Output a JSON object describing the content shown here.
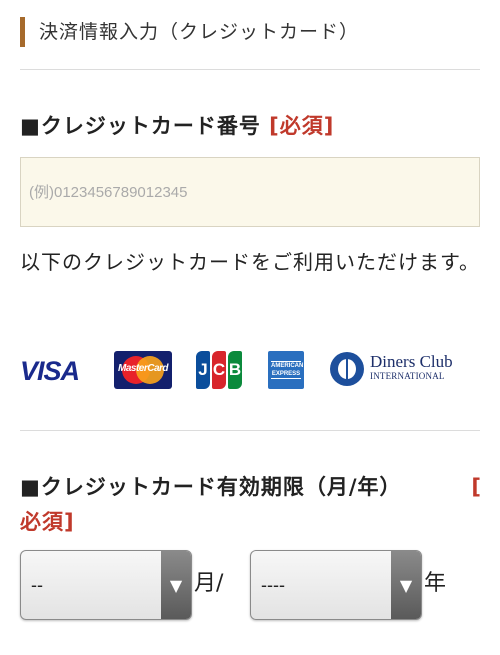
{
  "header": {
    "title": "決済情報入力（クレジットカード）"
  },
  "card_number": {
    "title": "■クレジットカード番号",
    "required": "[必須]",
    "placeholder": "(例)0123456789012345",
    "value": ""
  },
  "notice": "以下のクレジットカードをご利用いただけます。",
  "brands": {
    "visa": "VISA",
    "mastercard": "MasterCard",
    "jcb": [
      "J",
      "C",
      "B"
    ],
    "amex_lines": [
      "AMERICAN",
      "EXPRESS"
    ],
    "diners_line1": "Diners Club",
    "diners_line2": "INTERNATIONAL"
  },
  "expiry": {
    "title": "■クレジットカード有効期限（月/年）",
    "required_open": "[",
    "required_rest": "必須]",
    "month_value": "--",
    "month_unit": "月/",
    "year_value": "----",
    "year_unit": "年"
  },
  "colors": {
    "accent_bar": "#a66a2c",
    "required_red": "#c0392b",
    "input_bg": "#fbf8ea"
  },
  "icons": {
    "select_arrow": "triangle-down"
  }
}
